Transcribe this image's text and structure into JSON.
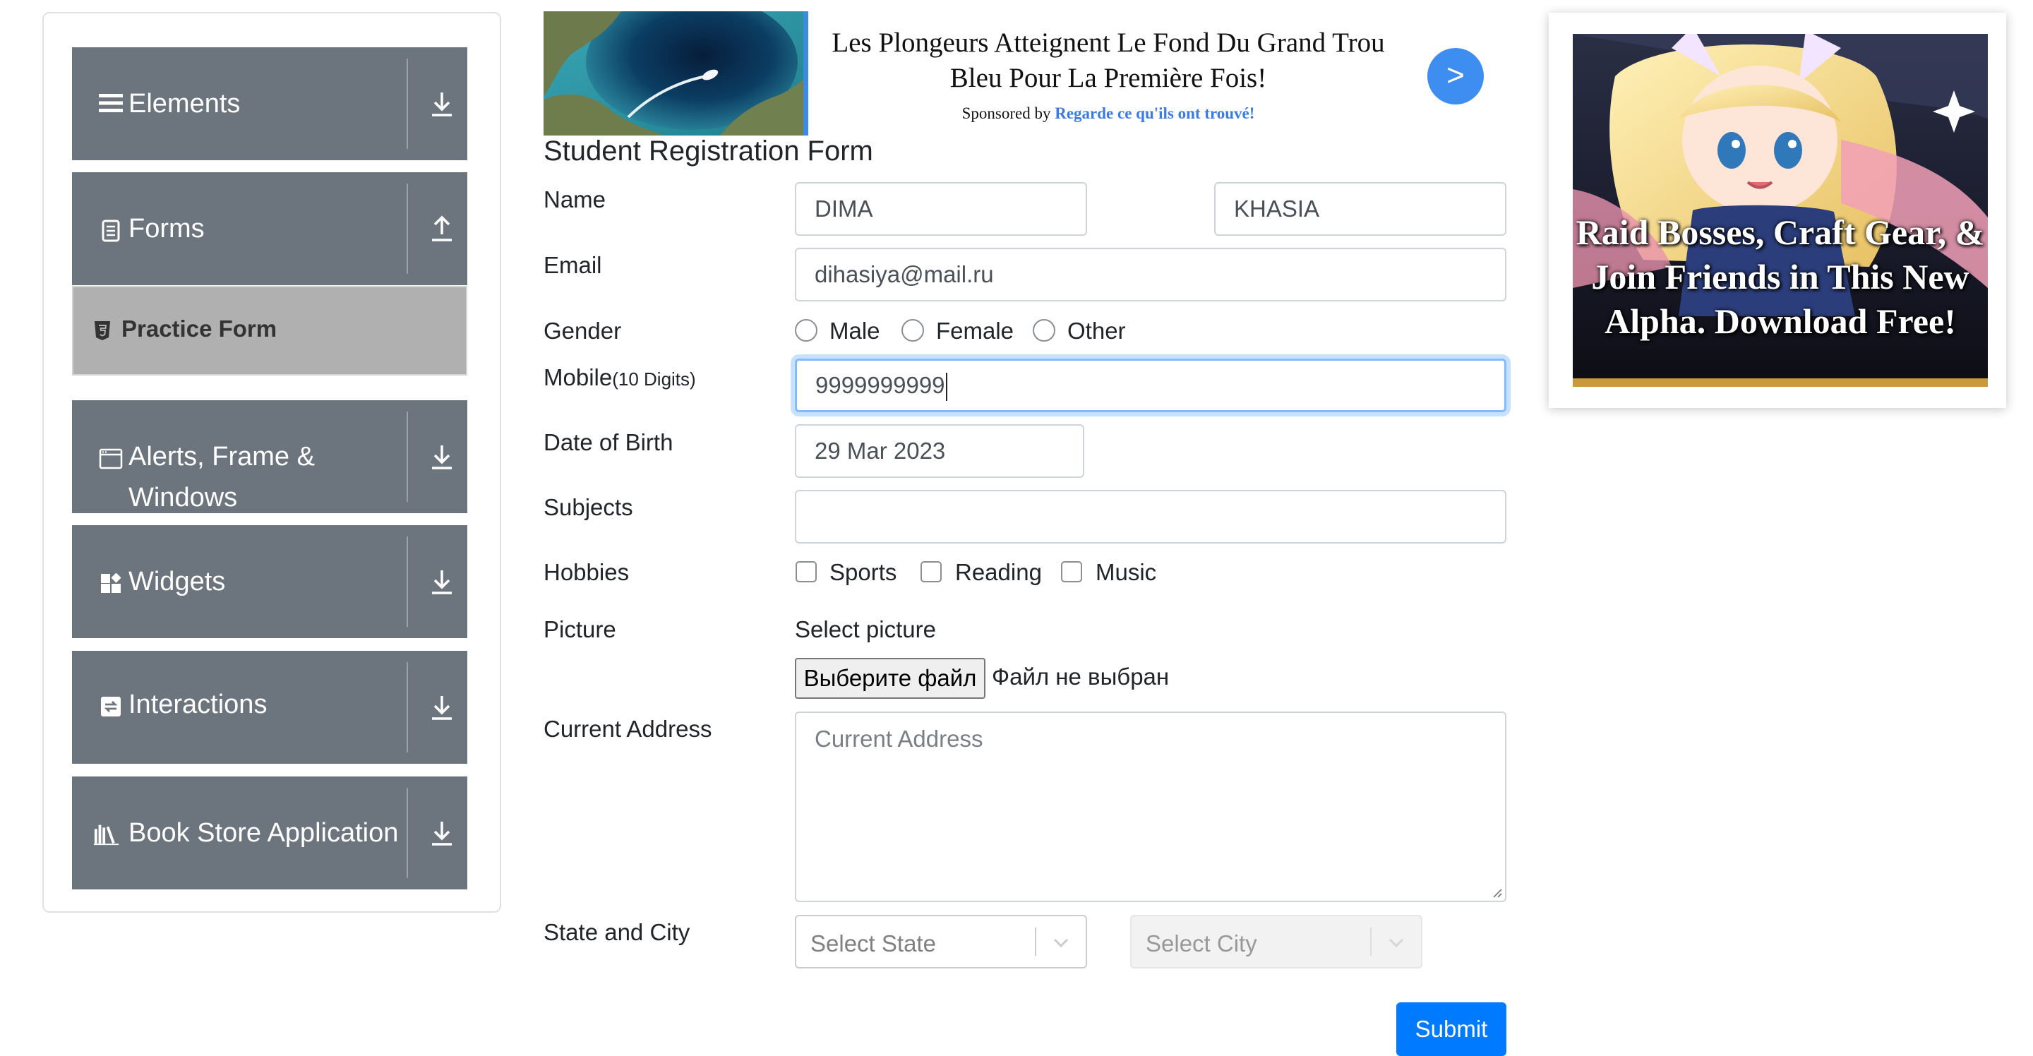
{
  "sidebar": {
    "groups": [
      {
        "label": "Elements",
        "icon": "hamburger-icon",
        "arrow": "download-arrow-icon"
      },
      {
        "label": "Forms",
        "icon": "document-icon",
        "arrow": "upload-arrow-icon",
        "expanded": true
      },
      {
        "label": "Alerts, Frame & Windows",
        "icon": "window-icon",
        "arrow": "download-arrow-icon"
      },
      {
        "label": "Widgets",
        "icon": "widgets-icon",
        "arrow": "download-arrow-icon"
      },
      {
        "label": "Interactions",
        "icon": "interactions-icon",
        "arrow": "download-arrow-icon"
      },
      {
        "label": "Book Store Application",
        "icon": "books-icon",
        "arrow": "download-arrow-icon"
      }
    ],
    "active_item": {
      "label": "Practice Form",
      "icon": "html5-shield-icon"
    }
  },
  "top_ad": {
    "headline": "Les Plongeurs Atteignent Le Fond Du Grand Trou Bleu Pour La Première Fois!",
    "sponsor_prefix": "Sponsored by",
    "sponsor_source": "Regarde ce qu'ils ont trouvé!",
    "arrow_label": ">"
  },
  "form": {
    "title": "Student Registration Form",
    "name_label": "Name",
    "first_name": "DIMA",
    "last_name": "KHASIA",
    "email_label": "Email",
    "email": "dihasiya@mail.ru",
    "gender_label": "Gender",
    "gender_options": [
      "Male",
      "Female",
      "Other"
    ],
    "mobile_label": "Mobile",
    "mobile_hint": "(10 Digits)",
    "mobile": "9999999999",
    "dob_label": "Date of Birth",
    "dob": "29 Mar 2023",
    "subjects_label": "Subjects",
    "subjects": "",
    "hobbies_label": "Hobbies",
    "hobbies": [
      "Sports",
      "Reading",
      "Music"
    ],
    "picture_label": "Picture",
    "picture_caption": "Select picture",
    "file_button": "Выберите файл",
    "file_status": "Файл не выбран",
    "address_label": "Current Address",
    "address_placeholder": "Current Address",
    "state_city_label": "State and City",
    "state_placeholder": "Select State",
    "city_placeholder": "Select City",
    "submit": "Submit"
  },
  "side_ad": {
    "text": "Raid Bosses, Craft Gear, & Join Friends in This New Alpha. Download Free!"
  },
  "colors": {
    "sidebar_group": "#6c757d",
    "active_item": "#b0b0b0",
    "primary": "#007bff",
    "focus_border": "#80bdff",
    "ad_arrow": "#3d8ef0"
  }
}
